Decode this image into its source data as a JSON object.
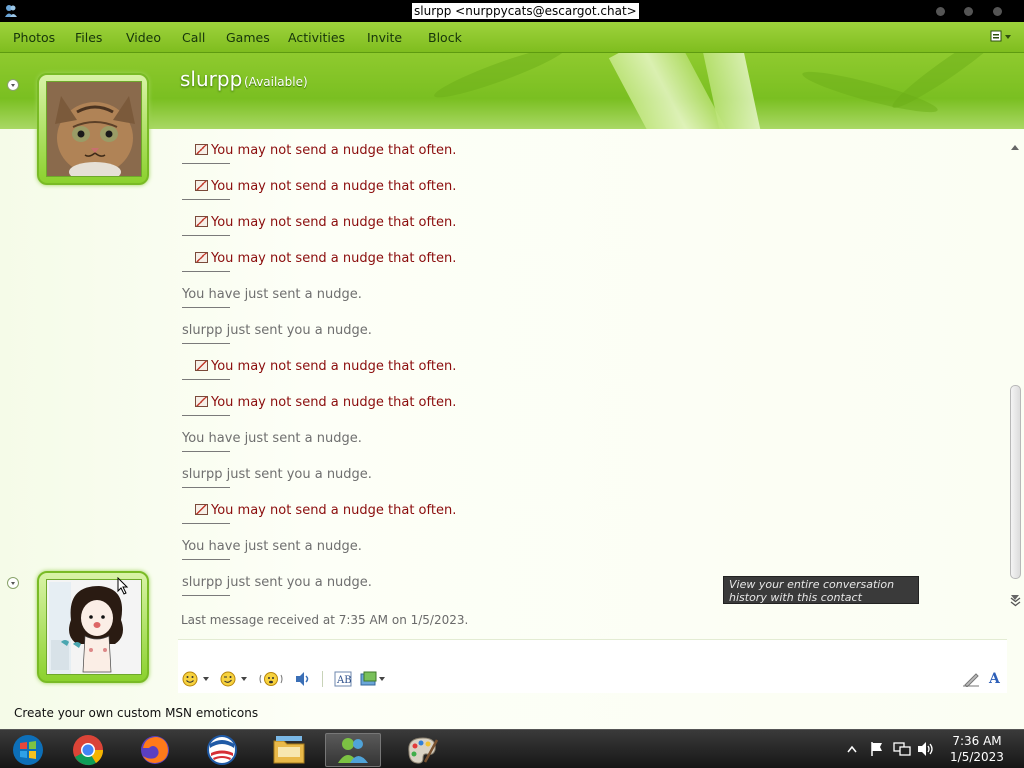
{
  "window": {
    "title": "slurpp <nurppycats@escargot.chat>"
  },
  "menu": {
    "items": [
      "Photos",
      "Files",
      "Video",
      "Call",
      "Games",
      "Activities",
      "Invite",
      "Block"
    ]
  },
  "contact": {
    "name": "slurpp",
    "status": "(Available)"
  },
  "messages": [
    {
      "type": "warn",
      "text": "You may not send a nudge that often."
    },
    {
      "type": "warn",
      "text": "You may not send a nudge that often."
    },
    {
      "type": "warn",
      "text": "You may not send a nudge that often."
    },
    {
      "type": "warn",
      "text": "You may not send a nudge that often."
    },
    {
      "type": "info",
      "text": "You have just sent a nudge."
    },
    {
      "type": "info",
      "text": "slurpp just sent you a nudge."
    },
    {
      "type": "warn",
      "text": "You may not send a nudge that often."
    },
    {
      "type": "warn",
      "text": "You may not send a nudge that often."
    },
    {
      "type": "info",
      "text": "You have just sent a nudge."
    },
    {
      "type": "info",
      "text": "slurpp just sent you a nudge."
    },
    {
      "type": "warn",
      "text": "You may not send a nudge that often."
    },
    {
      "type": "info",
      "text": "You have just sent a nudge."
    },
    {
      "type": "info",
      "text": "slurpp just sent you a nudge."
    }
  ],
  "last_message": "Last message received at 7:35 AM on 1/5/2023.",
  "tooltip": "View your entire conversation history with this contact",
  "custom_emoticons_link": "Create your own custom MSN emoticons",
  "input": {
    "value": "",
    "toolbar_icons": [
      "emoticon-icon",
      "wink-icon",
      "nudge-icon",
      "voice-clip-icon",
      "font-icon",
      "background-icon"
    ]
  },
  "scroll": {
    "position": 0.75
  },
  "taskbar": {
    "apps": [
      "windows-live-icon",
      "chrome-icon",
      "firefox-icon",
      "obama-icon",
      "file-manager-icon",
      "messenger-icon",
      "paint-icon"
    ],
    "active_app": "messenger-icon",
    "clock_time": "7:36 AM",
    "clock_date": "1/5/2023"
  },
  "colors": {
    "accent_green": "#7fbd1f",
    "warning_text": "#8b0d0d",
    "info_text": "#6f6f6f"
  }
}
